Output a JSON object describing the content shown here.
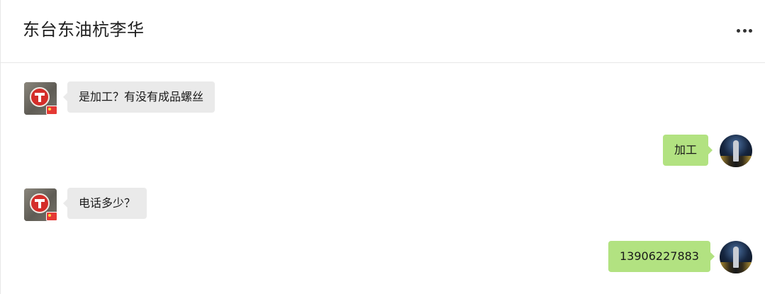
{
  "header": {
    "title": "东台东油杭李华",
    "more_icon": "more-dots-icon"
  },
  "messages": [
    {
      "direction": "incoming",
      "text": "是加工？有没有成品螺丝"
    },
    {
      "direction": "outgoing",
      "text": "加工"
    },
    {
      "direction": "incoming",
      "text": "电话多少？"
    },
    {
      "direction": "outgoing",
      "text": "13906227883"
    }
  ],
  "colors": {
    "incoming_bubble": "#eaeaea",
    "outgoing_bubble": "#b2e281",
    "divider": "#e7e7e7"
  }
}
